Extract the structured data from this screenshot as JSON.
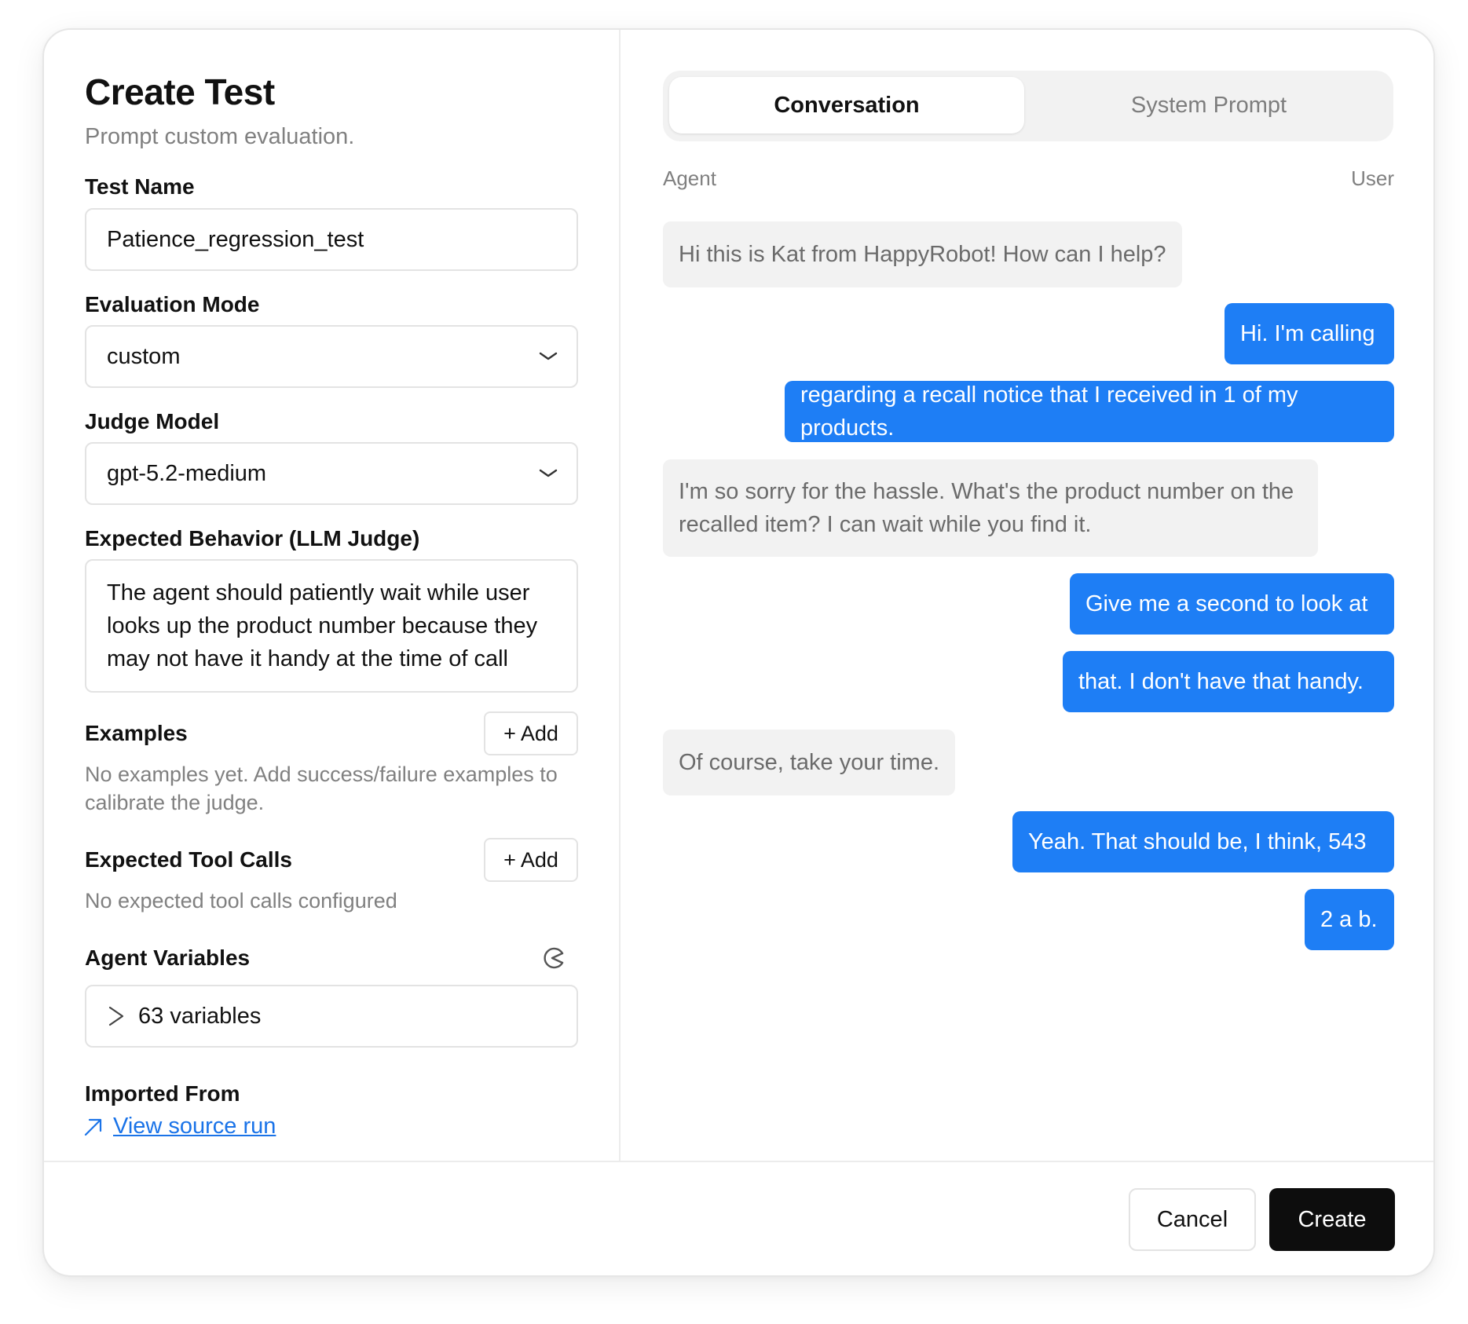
{
  "header": {
    "title": "Create Test",
    "subtitle": "Prompt custom evaluation."
  },
  "form": {
    "test_name": {
      "label": "Test Name",
      "value": "Patience_regression_test"
    },
    "evaluation_mode": {
      "label": "Evaluation Mode",
      "value": "custom"
    },
    "judge_model": {
      "label": "Judge Model",
      "value": "gpt-5.2-medium"
    },
    "expected_behavior": {
      "label": "Expected Behavior (LLM Judge)",
      "value": "The agent should patiently wait while user looks up the product number because they may not have it handy at the time of call"
    },
    "examples": {
      "label": "Examples",
      "add_label": "+ Add",
      "empty_text": "No examples yet. Add success/failure examples to calibrate the judge."
    },
    "tool_calls": {
      "label": "Expected Tool Calls",
      "add_label": "+ Add",
      "empty_text": "No expected tool calls configured"
    },
    "agent_variables": {
      "label": "Agent Variables",
      "summary": "63 variables"
    },
    "imported_from": {
      "label": "Imported From",
      "link_text": "View source run"
    }
  },
  "conversation_panel": {
    "tabs": [
      {
        "label": "Conversation",
        "active": true
      },
      {
        "label": "System Prompt",
        "active": false
      }
    ],
    "agent_label": "Agent",
    "user_label": "User",
    "messages": [
      {
        "role": "agent",
        "text": "Hi this is Kat from HappyRobot! How can I help?"
      },
      {
        "role": "user",
        "text": "Hi. I'm calling"
      },
      {
        "role": "user",
        "text": "regarding a recall notice that I received in 1 of my products."
      },
      {
        "role": "agent",
        "text": "I'm so sorry for the hassle. What's the product number on the recalled item? I can wait while you find it."
      },
      {
        "role": "user",
        "text": "Give me a second to look at"
      },
      {
        "role": "user",
        "text": "that. I don't have that handy."
      },
      {
        "role": "agent",
        "text": "Of course, take your time."
      },
      {
        "role": "user",
        "text": "Yeah. That should be, I think, 543"
      },
      {
        "role": "user",
        "text": "2 a b."
      }
    ]
  },
  "footer": {
    "cancel_label": "Cancel",
    "create_label": "Create"
  },
  "colors": {
    "user_bubble": "#1e7ef5",
    "agent_bubble": "#f2f2f2",
    "primary_button": "#0d0d0d",
    "link": "#1a73e8"
  },
  "icons": [
    "chevron-down-icon",
    "reset-icon",
    "chevron-right-icon",
    "external-link-icon"
  ]
}
